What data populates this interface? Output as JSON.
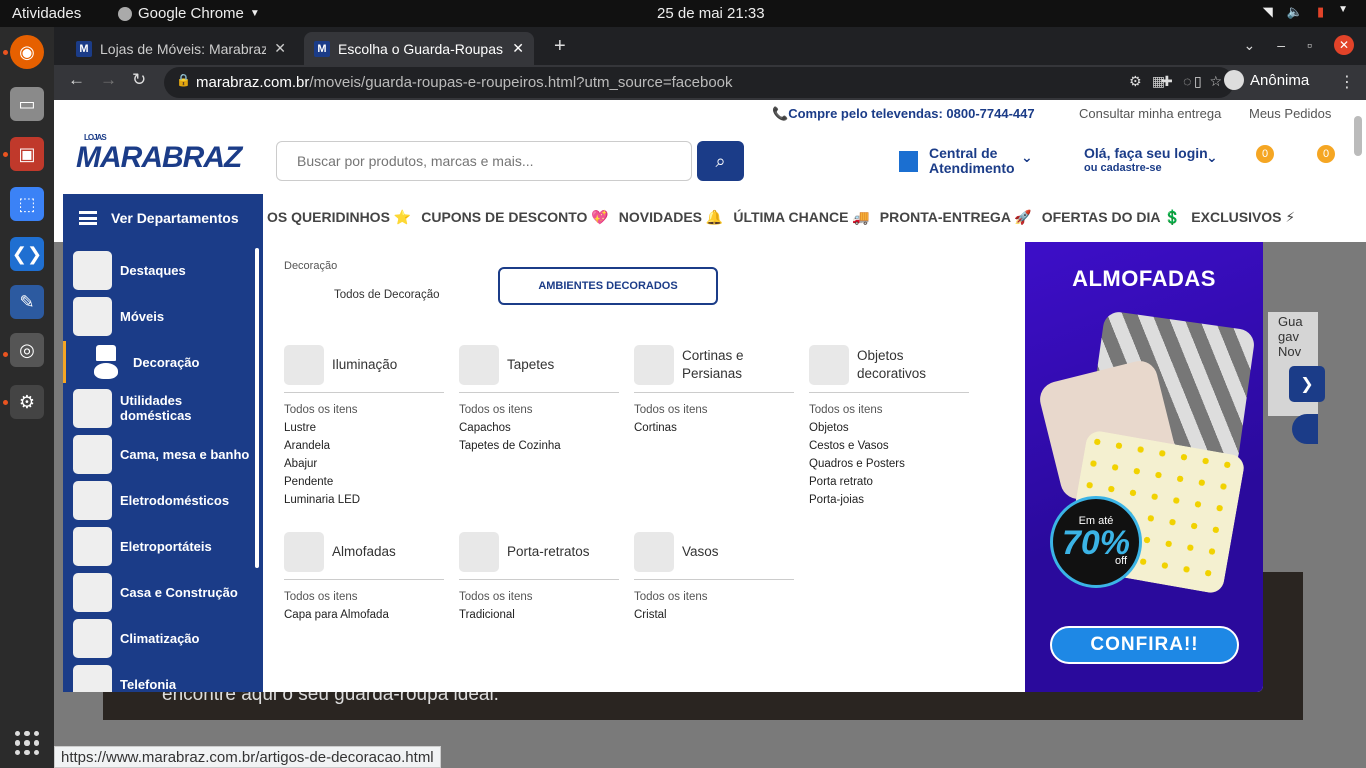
{
  "os": {
    "activities": "Atividades",
    "app_name": "Google Chrome",
    "clock": "25 de mai  21:33"
  },
  "browser": {
    "tabs": [
      {
        "title": "Lojas de Móveis: Marabraz",
        "active": false
      },
      {
        "title": "Escolha o Guarda-Roupas",
        "active": true
      }
    ],
    "url_host": "marabraz.com.br",
    "url_path": "/moveis/guarda-roupas-e-roupeiros.html?utm_source=facebook",
    "profile": "Anônima",
    "status_url": "https://www.marabraz.com.br/artigos-de-decoracao.html"
  },
  "site": {
    "util": {
      "phone": "Compre pelo televendas: 0800-7744-447",
      "delivery": "Consultar minha entrega",
      "orders": "Meus Pedidos"
    },
    "logo_small": "LOJAS",
    "logo": "MARABRAZ",
    "search_placeholder": "Buscar por produtos, marcas e mais...",
    "central_line1": "Central de",
    "central_line2": "Atendimento",
    "login_line1": "Olá, faça seu login",
    "login_line2": "ou cadastre-se",
    "badge1": "0",
    "badge2": "0",
    "menu_label": "Ver Departamentos",
    "categories": [
      "OS QUERIDINHOS ⭐",
      "CUPONS DE DESCONTO 💖",
      "NOVIDADES 🔔",
      "ÚLTIMA CHANCE 🚚",
      "PRONTA-ENTREGA 🚀",
      "OFERTAS DO DIA 💲",
      "EXCLUSIVOS ⚡"
    ],
    "departments": [
      "Destaques",
      "Móveis",
      "Decoração",
      "Utilidades domésticas",
      "Cama, mesa e banho",
      "Eletrodomésticos",
      "Eletroportáteis",
      "Casa e Construção",
      "Climatização",
      "Telefonia"
    ],
    "bg_text": "encontre aqui o seu guarda-roupa ideal.",
    "bg_side_text": [
      "Gua",
      "gav",
      "Nov"
    ]
  },
  "megamenu": {
    "breadcrumb": "Decoração",
    "all_link": "Todos de Decoração",
    "ambientes_button": "AMBIENTES DECORADOS",
    "columns": [
      {
        "name": "Iluminação",
        "links": [
          "Todos os itens",
          "Lustre",
          "Arandela",
          "Abajur",
          "Pendente",
          "Luminaria LED"
        ]
      },
      {
        "name": "Tapetes",
        "links": [
          "Todos os itens",
          "Capachos",
          "Tapetes de Cozinha"
        ]
      },
      {
        "name": "Cortinas e Persianas",
        "links": [
          "Todos os itens",
          "Cortinas"
        ]
      },
      {
        "name": "Objetos decorativos",
        "links": [
          "Todos os itens",
          "Objetos",
          "Cestos e Vasos",
          "Quadros e Posters",
          "Porta retrato",
          "Porta-joias"
        ]
      },
      {
        "name": "Almofadas",
        "links": [
          "Todos os itens",
          "Capa para Almofada"
        ]
      },
      {
        "name": "Porta-retratos",
        "links": [
          "Todos os itens",
          "Tradicional"
        ]
      },
      {
        "name": "Vasos",
        "links": [
          "Todos os itens",
          "Cristal"
        ]
      }
    ],
    "banner": {
      "title": "ALMOFADAS",
      "disc_top": "Em até",
      "disc_value": "70%",
      "disc_bottom": "off",
      "cta": "CONFIRA!!"
    }
  }
}
